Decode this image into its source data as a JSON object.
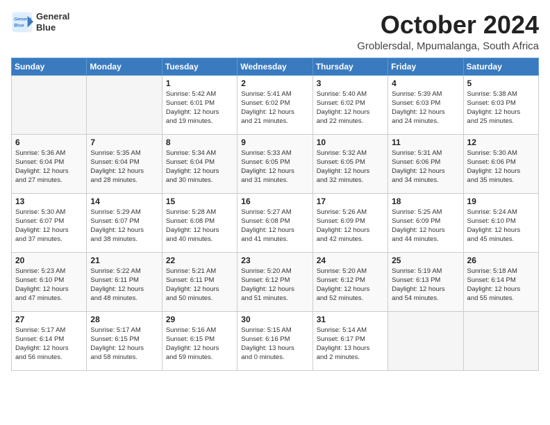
{
  "logo": {
    "line1": "General",
    "line2": "Blue"
  },
  "title": "October 2024",
  "location": "Groblersdal, Mpumalanga, South Africa",
  "weekdays": [
    "Sunday",
    "Monday",
    "Tuesday",
    "Wednesday",
    "Thursday",
    "Friday",
    "Saturday"
  ],
  "weeks": [
    [
      {
        "day": "",
        "info": ""
      },
      {
        "day": "",
        "info": ""
      },
      {
        "day": "1",
        "info": "Sunrise: 5:42 AM\nSunset: 6:01 PM\nDaylight: 12 hours\nand 19 minutes."
      },
      {
        "day": "2",
        "info": "Sunrise: 5:41 AM\nSunset: 6:02 PM\nDaylight: 12 hours\nand 21 minutes."
      },
      {
        "day": "3",
        "info": "Sunrise: 5:40 AM\nSunset: 6:02 PM\nDaylight: 12 hours\nand 22 minutes."
      },
      {
        "day": "4",
        "info": "Sunrise: 5:39 AM\nSunset: 6:03 PM\nDaylight: 12 hours\nand 24 minutes."
      },
      {
        "day": "5",
        "info": "Sunrise: 5:38 AM\nSunset: 6:03 PM\nDaylight: 12 hours\nand 25 minutes."
      }
    ],
    [
      {
        "day": "6",
        "info": "Sunrise: 5:36 AM\nSunset: 6:04 PM\nDaylight: 12 hours\nand 27 minutes."
      },
      {
        "day": "7",
        "info": "Sunrise: 5:35 AM\nSunset: 6:04 PM\nDaylight: 12 hours\nand 28 minutes."
      },
      {
        "day": "8",
        "info": "Sunrise: 5:34 AM\nSunset: 6:04 PM\nDaylight: 12 hours\nand 30 minutes."
      },
      {
        "day": "9",
        "info": "Sunrise: 5:33 AM\nSunset: 6:05 PM\nDaylight: 12 hours\nand 31 minutes."
      },
      {
        "day": "10",
        "info": "Sunrise: 5:32 AM\nSunset: 6:05 PM\nDaylight: 12 hours\nand 32 minutes."
      },
      {
        "day": "11",
        "info": "Sunrise: 5:31 AM\nSunset: 6:06 PM\nDaylight: 12 hours\nand 34 minutes."
      },
      {
        "day": "12",
        "info": "Sunrise: 5:30 AM\nSunset: 6:06 PM\nDaylight: 12 hours\nand 35 minutes."
      }
    ],
    [
      {
        "day": "13",
        "info": "Sunrise: 5:30 AM\nSunset: 6:07 PM\nDaylight: 12 hours\nand 37 minutes."
      },
      {
        "day": "14",
        "info": "Sunrise: 5:29 AM\nSunset: 6:07 PM\nDaylight: 12 hours\nand 38 minutes."
      },
      {
        "day": "15",
        "info": "Sunrise: 5:28 AM\nSunset: 6:08 PM\nDaylight: 12 hours\nand 40 minutes."
      },
      {
        "day": "16",
        "info": "Sunrise: 5:27 AM\nSunset: 6:08 PM\nDaylight: 12 hours\nand 41 minutes."
      },
      {
        "day": "17",
        "info": "Sunrise: 5:26 AM\nSunset: 6:09 PM\nDaylight: 12 hours\nand 42 minutes."
      },
      {
        "day": "18",
        "info": "Sunrise: 5:25 AM\nSunset: 6:09 PM\nDaylight: 12 hours\nand 44 minutes."
      },
      {
        "day": "19",
        "info": "Sunrise: 5:24 AM\nSunset: 6:10 PM\nDaylight: 12 hours\nand 45 minutes."
      }
    ],
    [
      {
        "day": "20",
        "info": "Sunrise: 5:23 AM\nSunset: 6:10 PM\nDaylight: 12 hours\nand 47 minutes."
      },
      {
        "day": "21",
        "info": "Sunrise: 5:22 AM\nSunset: 6:11 PM\nDaylight: 12 hours\nand 48 minutes."
      },
      {
        "day": "22",
        "info": "Sunrise: 5:21 AM\nSunset: 6:11 PM\nDaylight: 12 hours\nand 50 minutes."
      },
      {
        "day": "23",
        "info": "Sunrise: 5:20 AM\nSunset: 6:12 PM\nDaylight: 12 hours\nand 51 minutes."
      },
      {
        "day": "24",
        "info": "Sunrise: 5:20 AM\nSunset: 6:12 PM\nDaylight: 12 hours\nand 52 minutes."
      },
      {
        "day": "25",
        "info": "Sunrise: 5:19 AM\nSunset: 6:13 PM\nDaylight: 12 hours\nand 54 minutes."
      },
      {
        "day": "26",
        "info": "Sunrise: 5:18 AM\nSunset: 6:14 PM\nDaylight: 12 hours\nand 55 minutes."
      }
    ],
    [
      {
        "day": "27",
        "info": "Sunrise: 5:17 AM\nSunset: 6:14 PM\nDaylight: 12 hours\nand 56 minutes."
      },
      {
        "day": "28",
        "info": "Sunrise: 5:17 AM\nSunset: 6:15 PM\nDaylight: 12 hours\nand 58 minutes."
      },
      {
        "day": "29",
        "info": "Sunrise: 5:16 AM\nSunset: 6:15 PM\nDaylight: 12 hours\nand 59 minutes."
      },
      {
        "day": "30",
        "info": "Sunrise: 5:15 AM\nSunset: 6:16 PM\nDaylight: 13 hours\nand 0 minutes."
      },
      {
        "day": "31",
        "info": "Sunrise: 5:14 AM\nSunset: 6:17 PM\nDaylight: 13 hours\nand 2 minutes."
      },
      {
        "day": "",
        "info": ""
      },
      {
        "day": "",
        "info": ""
      }
    ]
  ]
}
